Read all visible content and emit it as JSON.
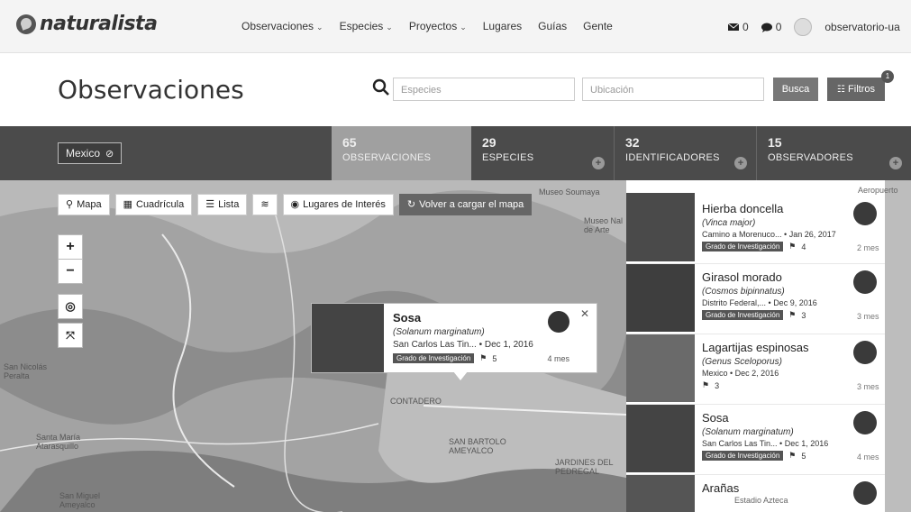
{
  "nav": {
    "logo": "naturalista",
    "menu": [
      {
        "label": "Observaciones",
        "caret": "⌄"
      },
      {
        "label": "Especies",
        "caret": "⌄"
      },
      {
        "label": "Proyectos",
        "caret": "⌄"
      },
      {
        "label": "Lugares",
        "caret": ""
      },
      {
        "label": "Guías",
        "caret": ""
      },
      {
        "label": "Gente",
        "caret": ""
      }
    ],
    "messages_count": "0",
    "notifications_count": "0",
    "username": "observatorio-ua"
  },
  "header": {
    "title": "Observaciones",
    "species_placeholder": "Especies",
    "location_placeholder": "Ubicación",
    "search_button": "Busca",
    "filters_button": "Filtros"
  },
  "stats": {
    "place": "Mexico",
    "observations": {
      "num": "65",
      "label": "OBSERVACIONES"
    },
    "species": {
      "num": "29",
      "label": "ESPECIES"
    },
    "identifiers": {
      "num": "32",
      "label": "IDENTIFICADORES"
    },
    "observers": {
      "num": "15",
      "label": "OBSERVADORES"
    }
  },
  "map": {
    "tools": {
      "map": "Mapa",
      "grid": "Cuadrícula",
      "list": "Lista",
      "places": "Lugares de Interés",
      "reload": "Volver a cargar el mapa"
    },
    "labels": {
      "museo_soumaya": "Museo Soumaya",
      "museo_arte": "Museo Nal de Arte",
      "contadero": "CONTADERO",
      "san_bartolo": "SAN BARTOLO AMEYALCO",
      "jardines": "JARDINES DEL PEDREGAL",
      "san_nicolas": "San Nicolás Peralta",
      "santa_maria": "Santa María Atarasquillo",
      "san_miguel": "San Miguel Ameyalco",
      "aeropuerto": "Aeropuerto",
      "estadio": "Estadio Azteca"
    },
    "popup": {
      "name": "Sosa",
      "scientific": "(Solanum marginatum)",
      "place": "San Carlos Las Tin...",
      "date": "Dec 1, 2016",
      "grade": "Grado de Investigación",
      "ids": "5",
      "ago": "4 mes"
    }
  },
  "observations": [
    {
      "name": "Hierba doncella",
      "scientific": "(Vinca major)",
      "place": "Camino a Morenuco...",
      "date": "Jan 26, 2017",
      "grade": "Grado de Investigación",
      "ids": "4",
      "ago": "2 mes"
    },
    {
      "name": "Girasol morado",
      "scientific": "(Cosmos bipinnatus)",
      "place": "Distrito Federal,...",
      "date": "Dec 9, 2016",
      "grade": "Grado de Investigación",
      "ids": "3",
      "ago": "3 mes"
    },
    {
      "name": "Lagartijas espinosas",
      "scientific": "(Genus Sceloporus)",
      "place": "Mexico",
      "date": "Dec 2, 2016",
      "grade": "",
      "ids": "3",
      "ago": "3 mes"
    },
    {
      "name": "Sosa",
      "scientific": "(Solanum marginatum)",
      "place": "San Carlos Las Tin...",
      "date": "Dec 1, 2016",
      "grade": "Grado de Investigación",
      "ids": "5",
      "ago": "4 mes"
    },
    {
      "name": "Arañas",
      "scientific": "",
      "place": "",
      "date": "",
      "grade": "",
      "ids": "",
      "ago": ""
    }
  ]
}
